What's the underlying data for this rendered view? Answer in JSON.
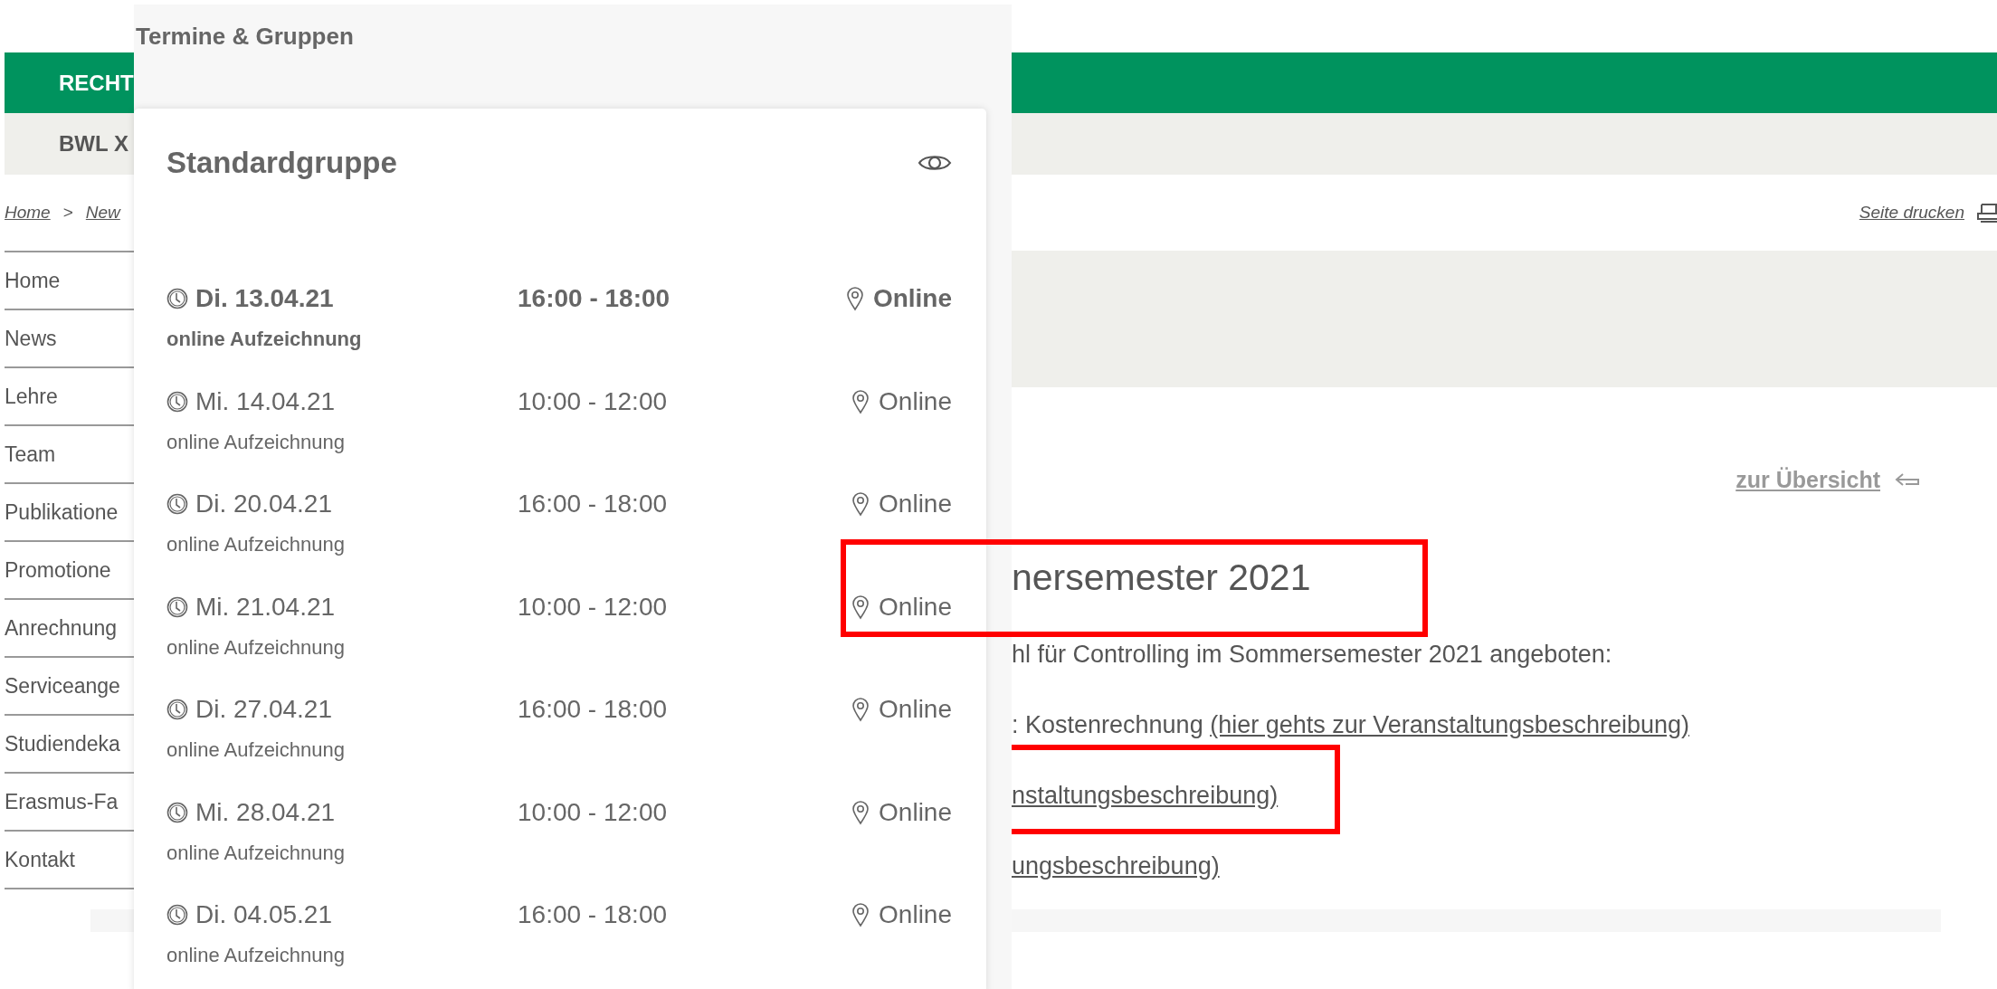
{
  "header": {
    "faculty": "RECHT",
    "department": "BWL X"
  },
  "breadcrumb": {
    "items": [
      "Home",
      "New"
    ],
    "separator": ">"
  },
  "print_link": "Seite drucken",
  "sidebar": {
    "items": [
      "Home",
      "News",
      "Lehre",
      "Team",
      "Publikatione",
      "Promotione",
      "Anrechnung",
      "Serviceange",
      "Studiendeka",
      "Erasmus-Fa",
      "Kontakt"
    ]
  },
  "main": {
    "back_link": "zur Übersicht",
    "heading": "nersemester 2021",
    "intro": "hl für Controlling im Sommersemester 2021 angeboten:",
    "lines": [
      {
        "text": ": Kostenrechnung ",
        "link": "(hier gehts zur Veranstaltungsbeschreibung)"
      },
      {
        "link": "nstaltungsbeschreibung)"
      },
      {
        "link": "ungsbeschreibung)"
      }
    ]
  },
  "panel": {
    "title": "Termine & Gruppen",
    "group": "Standardgruppe",
    "appointments": [
      {
        "date": "Di. 13.04.21",
        "time": "16:00 - 18:00",
        "location": "Online",
        "note": "online Aufzeichnung",
        "highlighted": true
      },
      {
        "date": "Mi. 14.04.21",
        "time": "10:00 - 12:00",
        "location": "Online",
        "note": "online Aufzeichnung",
        "highlighted": false
      },
      {
        "date": "Di. 20.04.21",
        "time": "16:00 - 18:00",
        "location": "Online",
        "note": "online Aufzeichnung",
        "highlighted": false
      },
      {
        "date": "Mi. 21.04.21",
        "time": "10:00 - 12:00",
        "location": "Online",
        "note": "online Aufzeichnung",
        "highlighted": false
      },
      {
        "date": "Di. 27.04.21",
        "time": "16:00 - 18:00",
        "location": "Online",
        "note": "online Aufzeichnung",
        "highlighted": false
      },
      {
        "date": "Mi. 28.04.21",
        "time": "10:00 - 12:00",
        "location": "Online",
        "note": "online Aufzeichnung",
        "highlighted": false
      },
      {
        "date": "Di. 04.05.21",
        "time": "16:00 - 18:00",
        "location": "Online",
        "note": "online Aufzeichnung",
        "highlighted": false
      }
    ]
  }
}
